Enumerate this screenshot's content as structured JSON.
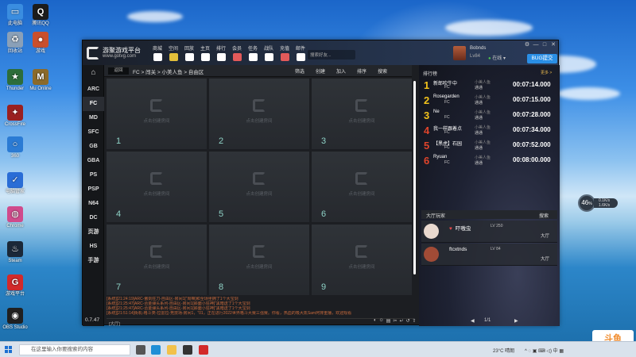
{
  "desktop": {
    "icons": [
      {
        "label": "此电脑",
        "color": "#3a8de0",
        "glyph": "▭"
      },
      {
        "label": "腾讯QQ",
        "color": "#1c1c1c",
        "glyph": "Q"
      },
      {
        "label": "回收站",
        "color": "#8aa0b8",
        "glyph": "♻"
      },
      {
        "label": "游戏",
        "color": "#c94f2c",
        "glyph": "●"
      },
      {
        "label": "Thunder",
        "color": "#2d6d3a",
        "glyph": "★"
      },
      {
        "label": "Mu Online",
        "color": "#8b6a2a",
        "glyph": "M"
      },
      {
        "label": "CrossFire",
        "color": "#9a2020",
        "glyph": "✦"
      },
      {
        "label": "360",
        "color": "#2b7bd4",
        "glyph": "○"
      },
      {
        "label": "电脑管家",
        "color": "#2a6dd6",
        "glyph": "✓"
      },
      {
        "label": "Chrome",
        "color": "#d04b8c",
        "glyph": "◍"
      },
      {
        "label": "Steam",
        "color": "#1b2838",
        "glyph": "♨"
      },
      {
        "label": "游戏平台",
        "color": "#d22a2a",
        "glyph": "G"
      },
      {
        "label": "OBS Studio",
        "color": "#202020",
        "glyph": "◉"
      }
    ]
  },
  "window": {
    "title": "游聚游戏平台",
    "subtitle": "www.gotvg.com",
    "nav": [
      "商城",
      "空间",
      "回放",
      "主页",
      "排行",
      "会员",
      "任务",
      "战队",
      "充值",
      "邮件"
    ],
    "nav_colors": [
      "#ffffff",
      "#e2bf3a",
      "#ffffff",
      "#ffffff",
      "#ffffff",
      "#e25a5a",
      "#ffffff",
      "#ffffff",
      "#e25a5a",
      "#ffffff"
    ],
    "search_placeholder": "搜索好友...",
    "user": {
      "name": "Bobnds",
      "level": "Lv84",
      "status": "在线"
    },
    "controls": [
      "⚙",
      "—",
      "□",
      "✕"
    ],
    "bug_button": "BUG提交",
    "version": "0.7.47"
  },
  "sidebar": {
    "home_icon": "⌂",
    "items": [
      "ARC",
      "FC",
      "MD",
      "SFC",
      "GB",
      "GBA",
      "PS",
      "PSP",
      "N64",
      "DC",
      "页游",
      "HS",
      "手游"
    ],
    "active": "FC"
  },
  "breadcrumb": {
    "tag": "返回",
    "path": "FC > 闯关 > 小美人鱼 > 自由区",
    "actions": [
      "筛选",
      "创建",
      "加入",
      "排序",
      "搜索"
    ]
  },
  "rooms": {
    "hint": "点击创建房间",
    "numbers": [
      "1",
      "2",
      "3",
      "4",
      "5",
      "6",
      "7",
      "8",
      "9"
    ]
  },
  "chatlog": [
    "[系统][21:24:19]ARC-傲剑狂刀-自由区-房间1[“周嘛]和全场坐拥了1个大宝剑",
    "[系统][21:25:47]ARC-合金弹头系列-自由区-房间1[斜面小狂神]“黑暗送了1个大宝剑",
    "[系统][21:25:47]ARC-合金弹头系列-自由区-房间1[斜面小狂神]“黑暗送了1个大宝剑",
    "[系统][21:51:14]街机-格斗类-拉雷拉-竞技场-房间1，“01，正在进行2022世界格斗大赛三强赛。你看，热血的吸大凯Sam阿排重播，欢迎观看"
  ],
  "chat_input": "[大厅]",
  "chat_tools": [
    "◐",
    "☺",
    "▤",
    "✂",
    "↵",
    "↺",
    "⇧",
    "≡"
  ],
  "ranking": {
    "title": "排行榜",
    "more": "更多 >",
    "rows": [
      {
        "rank": "1",
        "name": "新郎吹牛中",
        "platform": "FC",
        "mode1": "小美人鱼",
        "mode2": "通通",
        "time": "00:07:14.000",
        "color": "#f2c21b"
      },
      {
        "rank": "2",
        "name": "Rosegarden",
        "platform": "FC",
        "mode1": "小美人鱼",
        "mode2": "通通",
        "time": "00:07:15.000",
        "color": "#f2c21b"
      },
      {
        "rank": "3",
        "name": "Ne",
        "platform": "FC",
        "mode1": "小美人鱼",
        "mode2": "通通",
        "time": "00:07:28.000",
        "color": "#f2c21b"
      },
      {
        "rank": "4",
        "name": "我一样跟着点",
        "platform": "FC",
        "mode1": "小美人鱼",
        "mode2": "通通",
        "time": "00:07:34.000",
        "color": "#e0442b"
      },
      {
        "rank": "5",
        "name": "【黑虎】石园",
        "platform": "FC",
        "mode1": "小美人鱼",
        "mode2": "通通",
        "time": "00:07:52.000",
        "color": "#e0442b"
      },
      {
        "rank": "6",
        "name": "Ryuan",
        "platform": "FC",
        "mode1": "小美人鱼",
        "mode2": "通通",
        "time": "00:08:00.000",
        "color": "#e0442b"
      }
    ]
  },
  "hall": {
    "title": "大厅玩家",
    "search": "搜索",
    "users": [
      {
        "name": "吓嗷虫",
        "level": "LV 250",
        "action": "大厅",
        "heart": "♥",
        "avatar": "#e9d9cf"
      },
      {
        "name": "ftcxtnds",
        "level": "LV 84",
        "action": "大厅",
        "heart": "",
        "avatar": "#a14b36"
      }
    ],
    "pager": {
      "prev": "◀",
      "page": "1/1",
      "next": "▶"
    }
  },
  "net_widget": {
    "value": "46",
    "unit": "%",
    "up": "0.1K/s",
    "down": "1.6K/s"
  },
  "douyu": {
    "name": "斗鱼",
    "sub": "DOUYU.COM"
  },
  "taskbar": {
    "search_placeholder": "在这里输入你要搜索的内容",
    "weather": "23°C 晴朗",
    "time": "",
    "apps": [
      {
        "name": "task-view",
        "color": "#555555"
      },
      {
        "name": "edge",
        "color": "#1f8fd6"
      },
      {
        "name": "explorer",
        "color": "#f2c14a"
      },
      {
        "name": "obs",
        "color": "#333333"
      },
      {
        "name": "game-platform",
        "color": "#d22a2a"
      }
    ]
  }
}
